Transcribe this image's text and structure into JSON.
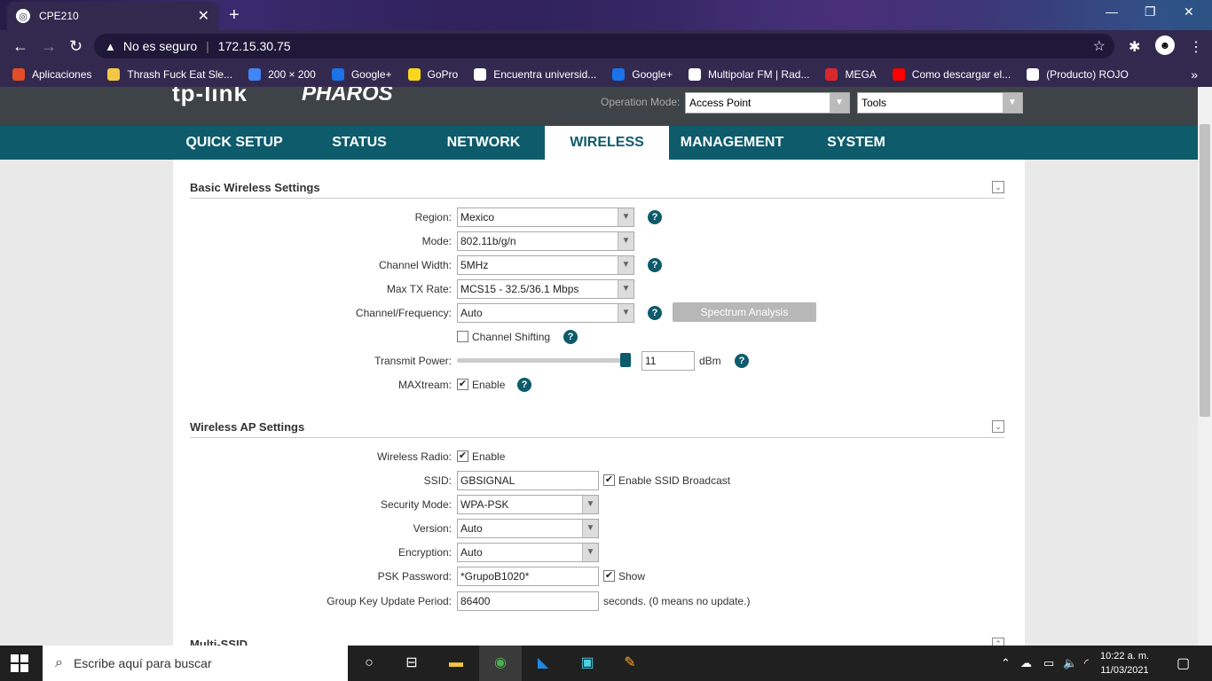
{
  "browser": {
    "tab_title": "CPE210",
    "tab_close": "✕",
    "new_tab": "+",
    "security_label": "No es seguro",
    "url": "172.15.30.75",
    "bookmarks": [
      {
        "label": "Aplicaciones",
        "color": "#e34c26"
      },
      {
        "label": "Thrash Fuck Eat Sle...",
        "color": "#f2c744"
      },
      {
        "label": "200 × 200",
        "color": "#4285f4"
      },
      {
        "label": "Google+",
        "color": "#1a73e8"
      },
      {
        "label": "GoPro",
        "color": "#f9d71c"
      },
      {
        "label": "Encuentra universid...",
        "color": "#ffffff"
      },
      {
        "label": "Google+",
        "color": "#1a73e8"
      },
      {
        "label": "Multipolar FM | Rad...",
        "color": "#ffffff"
      },
      {
        "label": "MEGA",
        "color": "#d9272e"
      },
      {
        "label": "Como descargar el...",
        "color": "#ff0000"
      },
      {
        "label": "(Producto) ROJO",
        "color": "#ffffff"
      }
    ]
  },
  "header": {
    "logo": "tp-link",
    "logo_product": "PHAROS",
    "operation_mode_label": "Operation Mode:",
    "operation_mode_value": "Access Point",
    "tools_value": "Tools"
  },
  "nav": {
    "items": [
      "QUICK SETUP",
      "STATUS",
      "NETWORK",
      "WIRELESS",
      "MANAGEMENT",
      "SYSTEM"
    ],
    "active": "WIRELESS"
  },
  "basic": {
    "title": "Basic Wireless Settings",
    "region_label": "Region:",
    "region_value": "Mexico",
    "mode_label": "Mode:",
    "mode_value": "802.11b/g/n",
    "channel_width_label": "Channel Width:",
    "channel_width_value": "5MHz",
    "max_tx_label": "Max TX Rate:",
    "max_tx_value": "MCS15 - 32.5/36.1 Mbps",
    "channel_freq_label": "Channel/Frequency:",
    "channel_freq_value": "Auto",
    "spectrum_button": "Spectrum Analysis",
    "channel_shifting_label": "Channel Shifting",
    "channel_shifting_checked": false,
    "transmit_power_label": "Transmit Power:",
    "transmit_power_value": "11",
    "transmit_power_unit": "dBm",
    "transmit_power_level": 1.0,
    "maxtream_label": "MAXtream:",
    "maxtream_enable": "Enable",
    "maxtream_checked": true
  },
  "ap": {
    "title": "Wireless AP Settings",
    "radio_label": "Wireless Radio:",
    "radio_enable": "Enable",
    "ssid_label": "SSID:",
    "ssid_value": "GBSIGNAL",
    "ssid_broadcast_label": "Enable SSID Broadcast",
    "security_mode_label": "Security Mode:",
    "security_mode_value": "WPA-PSK",
    "version_label": "Version:",
    "version_value": "Auto",
    "encryption_label": "Encryption:",
    "encryption_value": "Auto",
    "psk_label": "PSK Password:",
    "psk_value": "*GrupoB1020*",
    "psk_show": "Show",
    "group_key_label": "Group Key Update Period:",
    "group_key_value": "86400",
    "group_key_note": "seconds. (0 means no update.)"
  },
  "multi_ssid": {
    "title": "Multi-SSID"
  },
  "taskbar": {
    "search_placeholder": "Escribe aquí para buscar",
    "time": "10:22 a. m.",
    "date": "11/03/2021"
  },
  "icons": {
    "help": "?",
    "check": "✔",
    "dropdown": "▼"
  }
}
